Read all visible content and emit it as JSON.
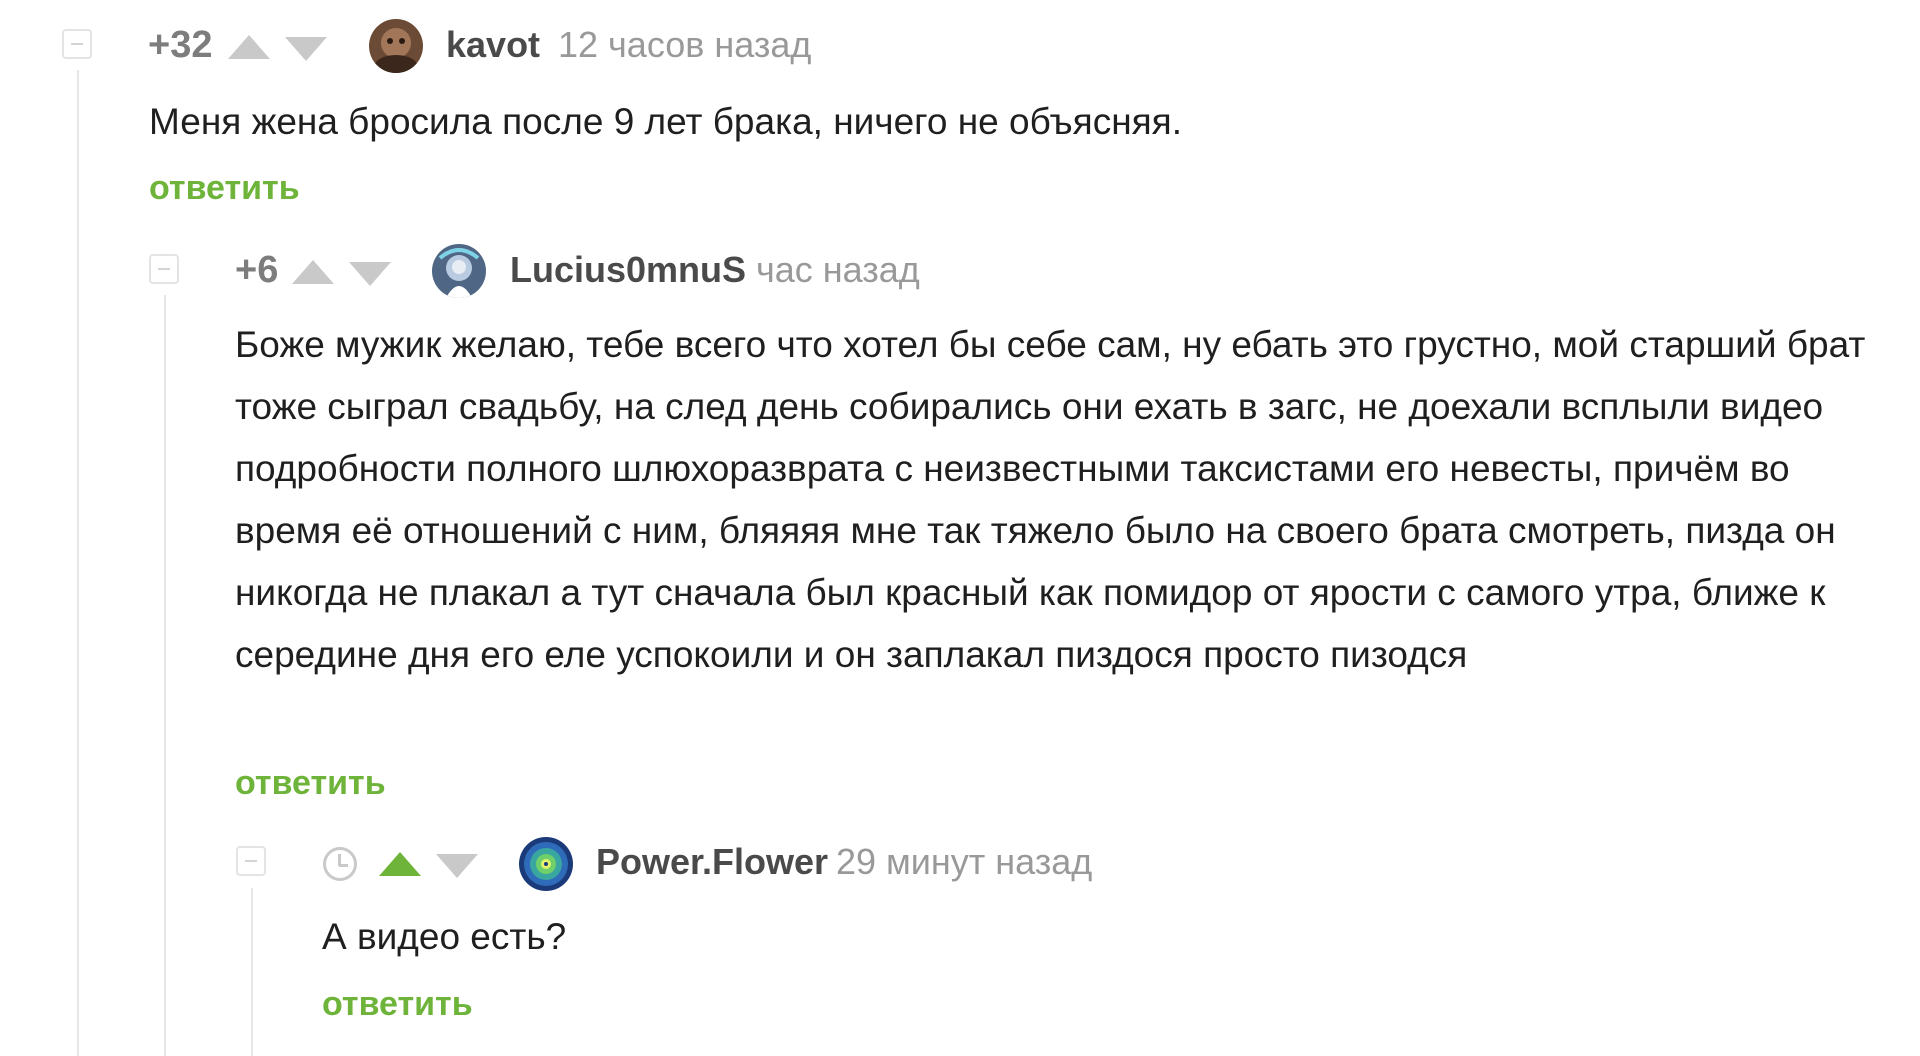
{
  "comments": [
    {
      "rating": "+32",
      "username": "kavot",
      "time": "12 часов назад",
      "text": "Меня жена бросила после 9 лет брака, ничего не объясняя.",
      "reply_label": "ответить"
    },
    {
      "rating": "+6",
      "username": "Lucius0mnuS",
      "time": "час назад",
      "text": "Боже мужик желаю, тебе всего что хотел бы себе сам, ну ебать это грустно, мой старший брат тоже сыграл свадьбу, на след день собирались они ехать в загс, не доехали всплыли видео подробности полного шлюхоразврата с неизвестными таксистами его невесты, причём во время её отношений с ним, бляяяя мне так тяжело было на своего брата смотреть, пизда он никогда не плакал а тут сначала был красный как помидор от ярости с самого утра, ближе к середине дня его еле успокоили и он заплакал пиздося просто пизодся",
      "reply_label": "ответить"
    },
    {
      "rating_icon": "clock-icon",
      "username": "Power.Flower",
      "time": "29 минут назад",
      "text": "А видео есть?",
      "reply_label": "ответить"
    }
  ],
  "colors": {
    "accent": "#6fb43a",
    "muted": "#999999",
    "vote_inactive": "#c9c9c9"
  }
}
